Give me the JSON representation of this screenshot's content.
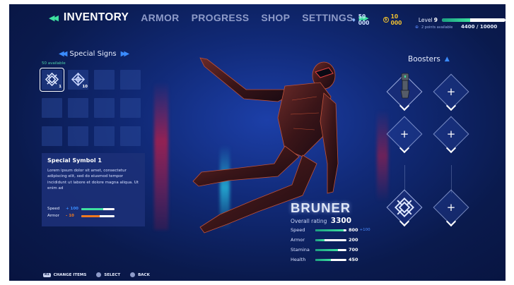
{
  "nav": {
    "tabs": [
      "INVENTORY",
      "ARMOR",
      "PROGRESS",
      "SHOP",
      "SETTINGS"
    ],
    "active": "INVENTORY",
    "icons": [
      "double-chevron-left-icon",
      "double-chevron-right-icon"
    ]
  },
  "currency": {
    "gems": "50 000",
    "coins": "10 000"
  },
  "level": {
    "label": "Level",
    "value": "9",
    "progress": 0.44
  },
  "points": {
    "available": "2 points available",
    "xp": "4400 / 10000"
  },
  "special_signs": {
    "title": "Special Signs",
    "available": "50 available",
    "slots": [
      {
        "count": "1",
        "selected": true
      },
      {
        "count": "10",
        "selected": false
      }
    ]
  },
  "info_card": {
    "title": "Special Symbol 1",
    "text": "Lorem ipsum dolor sit amet, consectetur adipiscing elit, sed do eiusmod tempor incididunt ut labore et dolore magna aliqua. Ut enim ad",
    "stats": [
      {
        "name": "Speed",
        "value": "+ 100",
        "level": 0.65,
        "color": "#3ee0a0"
      },
      {
        "name": "Armor",
        "value": "- 10",
        "level": 0.55,
        "color": "#f07a20"
      }
    ]
  },
  "character": {
    "name": "BRUNER",
    "rating_label": "Overall rating",
    "rating": "3300",
    "stats": [
      {
        "name": "Speed",
        "value": "800",
        "bonus": "+100",
        "level": 0.92
      },
      {
        "name": "Armor",
        "value": "200",
        "bonus": "",
        "level": 0.3
      },
      {
        "name": "Stamina",
        "value": "700",
        "bonus": "",
        "level": 0.72
      },
      {
        "name": "Health",
        "value": "450",
        "bonus": "",
        "level": 0.5
      }
    ]
  },
  "boosters": {
    "title": "Boosters",
    "slots": [
      "robot-arm",
      "plus-icon",
      "plus-icon",
      "plus-icon",
      "special-symbol",
      "plus-icon"
    ]
  },
  "hints": {
    "change_key": "R1",
    "change": "CHANGE ITEMS",
    "select": "SELECT",
    "back": "BACK"
  },
  "colors": {
    "bg": "#0a1a4d",
    "accent": "#3ee0a0",
    "blue": "#3a8cff",
    "orange": "#f07a20",
    "gold": "#f2c230"
  }
}
